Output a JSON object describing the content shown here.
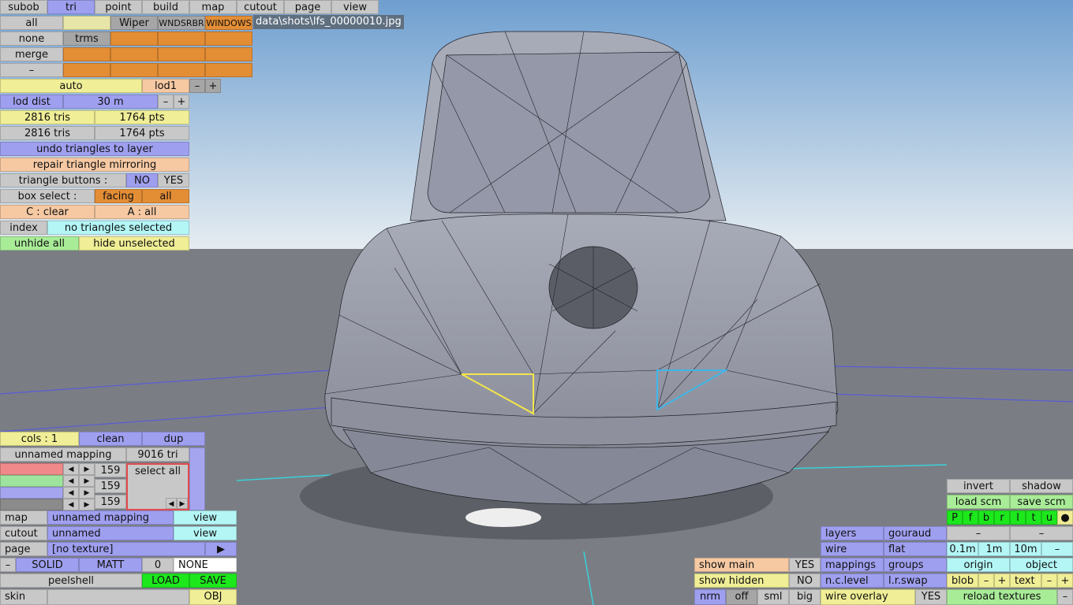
{
  "filename": "data\\shots\\lfs_00000010.jpg",
  "tabs": [
    "subob",
    "tri",
    "point",
    "build",
    "map",
    "cutout",
    "page",
    "view"
  ],
  "row1": {
    "all": "all",
    "wiper": "Wiper",
    "wndsrbr": "WNDSRBR",
    "windows": "WINDOWS"
  },
  "row2": {
    "none": "none",
    "trms": "trms"
  },
  "row3": {
    "merge": "merge"
  },
  "row4": {
    "minus": "–"
  },
  "lod": {
    "auto": "auto",
    "lod1": "lod1",
    "minus": "–",
    "plus": "+",
    "dist_label": "lod dist",
    "dist_value": "30 m",
    "dist_minus": "–",
    "dist_plus": "+"
  },
  "stats": {
    "tris1": "2816 tris",
    "pts1": "1764 pts",
    "tris2": "2816 tris",
    "pts2": "1764 pts"
  },
  "tri_panel": {
    "undo": "undo triangles to layer",
    "repair": "repair triangle mirroring",
    "tri_buttons": "triangle buttons :",
    "no": "NO",
    "yes": "YES",
    "box_select": "box select :",
    "facing": "facing",
    "all": "all",
    "clear": "C : clear",
    "a_all": "A : all",
    "index": "index",
    "no_sel": "no triangles selected",
    "unhide": "unhide all",
    "hide_unsel": "hide unselected"
  },
  "mapping_panel": {
    "cols": "cols : 1",
    "clean": "clean",
    "dup": "dup",
    "mapping_name": "unnamed mapping",
    "tri_count": "9016 tri",
    "v1": "159",
    "v2": "159",
    "v3": "159",
    "select_all": "select all",
    "map": "map",
    "map_value": "unnamed mapping",
    "map_view": "view",
    "cutout": "cutout",
    "cutout_value": "unnamed",
    "cutout_view": "view",
    "page": "page",
    "page_value": "[no texture]",
    "minus": "–",
    "solid": "SOLID",
    "matt": "MATT",
    "zero": "0",
    "none": "NONE",
    "peelshell": "peelshell",
    "load": "LOAD",
    "save": "SAVE",
    "skin": "skin",
    "obj": "OBJ"
  },
  "bottom_mid": {
    "show_main": "show main",
    "show_main_v": "YES",
    "show_hidden": "show hidden",
    "show_hidden_v": "NO",
    "nrm": "nrm",
    "off": "off",
    "sml": "sml",
    "big": "big"
  },
  "bottom_right": {
    "invert": "invert",
    "shadow": "shadow",
    "load_scm": "load scm",
    "save_scm": "save scm",
    "flags": [
      "P",
      "f",
      "b",
      "r",
      "l",
      "t",
      "u",
      "●"
    ],
    "layers": "layers",
    "gouraud": "gouraud",
    "wire": "wire",
    "flat": "flat",
    "d01": "0.1m",
    "d1": "1m",
    "d10": "10m",
    "mappings": "mappings",
    "groups": "groups",
    "origin": "origin",
    "object": "object",
    "ncl": "n.c.level",
    "lrswap": "l.r.swap",
    "blob": "blob",
    "text": "text",
    "wire_overlay": "wire overlay",
    "wire_overlay_v": "YES",
    "reload": "reload textures",
    "dash": "–",
    "minus": "–",
    "plus": "+"
  },
  "colors": {
    "sky_top": "#6f9fd0",
    "sky_bottom": "#e6edf1",
    "ground": "#7a7e84",
    "accent_orange": "#e38d35",
    "accent_blue": "#9f9ff0"
  }
}
